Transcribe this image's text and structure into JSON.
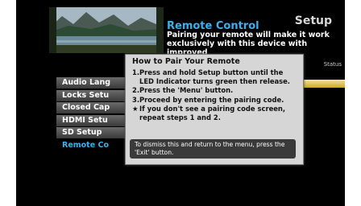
{
  "header": {
    "title": "Remote Control",
    "section": "Setup",
    "description": "Pairing your remote will make it work exclusively with this device with improved"
  },
  "status": {
    "label": "Status"
  },
  "menu": {
    "items": [
      {
        "label": "Audio Lang"
      },
      {
        "label": "Locks Setu"
      },
      {
        "label": "Closed Cap"
      },
      {
        "label": "HDMI Setu"
      },
      {
        "label": "SD Setup"
      },
      {
        "label": "Remote Co"
      }
    ],
    "selected_index": 5
  },
  "popup": {
    "title": "How to Pair Your Remote",
    "steps": [
      {
        "marker": "1.",
        "text": "Press and hold Setup button until the LED Indicator turns green then release."
      },
      {
        "marker": "2.",
        "text": "Press the 'Menu' button."
      },
      {
        "marker": "3.",
        "text": "Proceed by entering the pairing code."
      },
      {
        "marker": "★",
        "text": "If you don't see a pairing code screen, repeat steps 1 and 2."
      }
    ],
    "dismiss": "To dismiss this and return to the menu, press the 'Exit' button."
  },
  "colors": {
    "accent": "#3db0ea",
    "status_bar": "#e0c54a",
    "popup_bg": "#d6d6d6",
    "background": "#000000"
  }
}
